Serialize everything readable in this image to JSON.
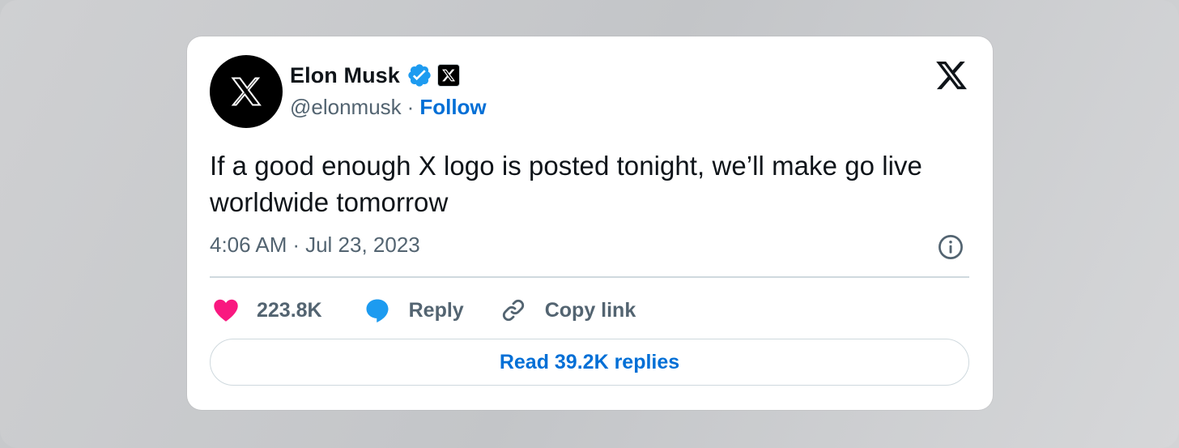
{
  "author": {
    "name": "Elon Musk",
    "handle": "@elonmusk",
    "separator": "·",
    "follow_label": "Follow",
    "avatar_icon": "x-logo-icon",
    "verified_icon": "verified-badge-icon",
    "affiliation_icon": "x-affiliation-badge-icon"
  },
  "tweet": {
    "text": "If a good enough X logo is posted tonight, we’ll make go live worldwide tomorrow",
    "time": "4:06 AM",
    "separator": "·",
    "date": "Jul 23, 2023"
  },
  "actions": {
    "like_count": "223.8K",
    "reply_label": "Reply",
    "copy_label": "Copy link"
  },
  "read_replies_label": "Read 39.2K replies",
  "colors": {
    "accent": "#006fd6",
    "like": "#f91880",
    "reply_icon": "#1d9bf0",
    "muted_text": "#536471",
    "text": "#0f1419",
    "verified": "#1d9bf0"
  }
}
